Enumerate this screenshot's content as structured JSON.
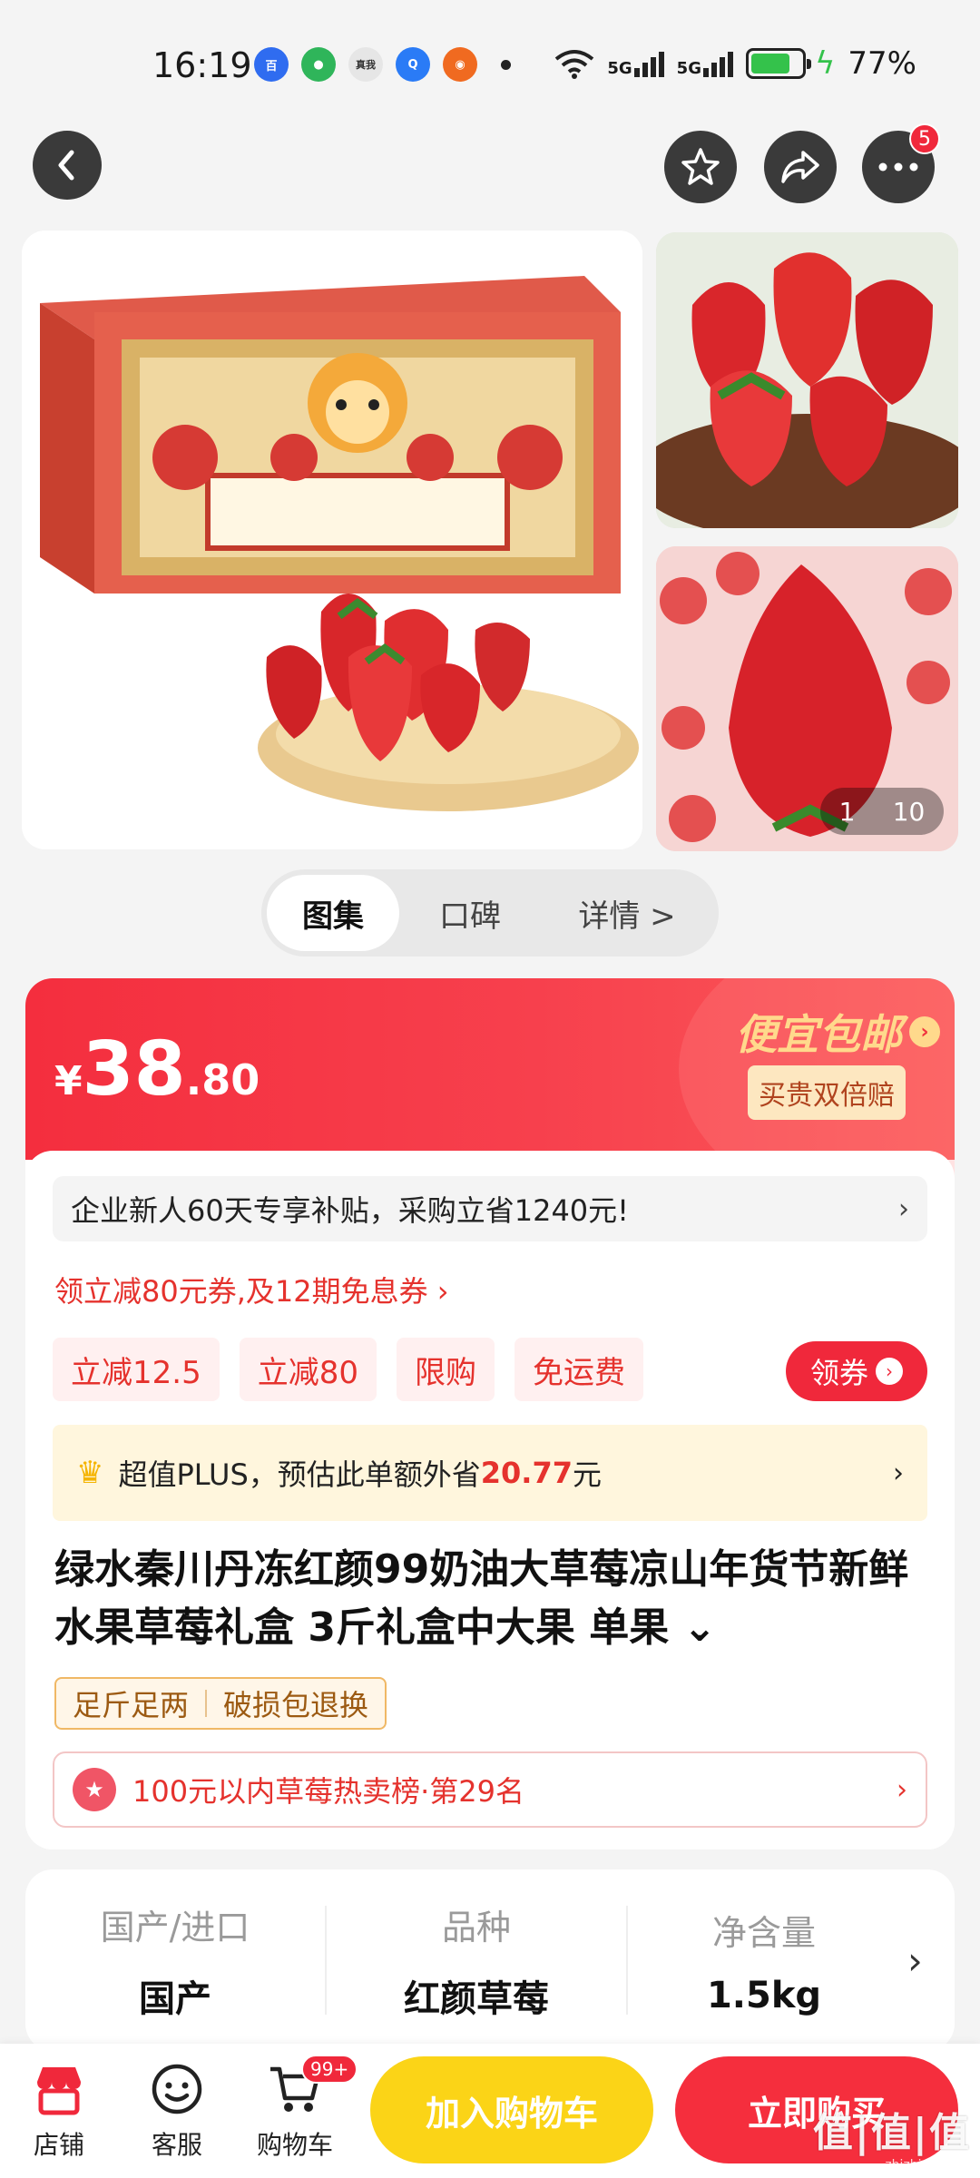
{
  "status_bar": {
    "time": "16:19",
    "net1": "5G",
    "net2": "5G",
    "battery": "77%",
    "battery_level": 0.77
  },
  "nav": {
    "cart_badge_count": "5"
  },
  "gallery": {
    "current": "1",
    "total": "10"
  },
  "tabs": [
    "图集",
    "口碑",
    "详情 >"
  ],
  "price": {
    "currency": "¥",
    "integer": "38",
    "decimal": ".80",
    "promo_title": "便宜包邮",
    "promo_sub": "买贵双倍赔"
  },
  "subsidy": "企业新人60天专享补贴，采购立省1240元!",
  "coupon_line": "领立减80元券,及12期免息券 ›",
  "tags": [
    "立减12.5",
    "立减80",
    "限购",
    "免运费"
  ],
  "get_coupon_label": "领券",
  "plus": {
    "text_before": "超值PLUS，预估此单额外省",
    "amount": "20.77",
    "text_after": "元"
  },
  "product_title": "绿水秦川丹冻红颜99奶油大草莓凉山年货节新鲜水果草莓礼盒 3斤礼盒中大果 单果 ⌄",
  "feature_tags": [
    "足斤足两",
    "破损包退换"
  ],
  "rank": "100元以内草莓热卖榜·第29名",
  "specs": [
    {
      "key": "国产/进口",
      "value": "国产"
    },
    {
      "key": "品种",
      "value": "红颜草莓"
    },
    {
      "key": "净含量",
      "value": "1.5kg"
    }
  ],
  "bottom_nav": {
    "shop": "店铺",
    "service": "客服",
    "cart": "购物车",
    "cart_badge": "99+",
    "add_to_cart": "加入购物车",
    "buy_now": "立即购买"
  },
  "watermark": {
    "text": "值|值|值",
    "url": "zhizhizhi.com"
  },
  "colors": {
    "primary_red": "#f52e3d",
    "cart_yellow": "#fbd417",
    "promo_gold": "#ffd98c"
  }
}
